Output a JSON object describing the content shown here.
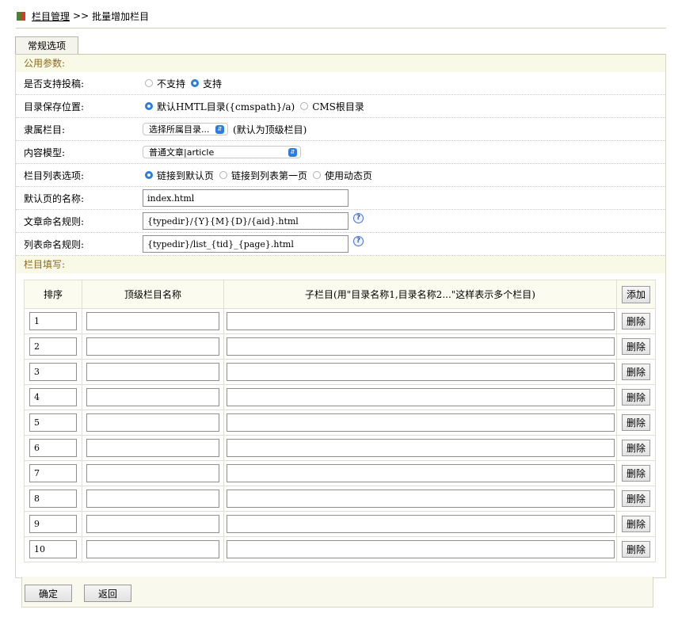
{
  "breadcrumb": {
    "link": "栏目管理",
    "sep": ">>",
    "current": "批量增加栏目"
  },
  "tab": "常规选项",
  "common": {
    "title": "公用参数:",
    "allow_submit": {
      "label": "是否支持投稿:",
      "opt_no": "不支持",
      "opt_yes": "支持",
      "selected": "支持"
    },
    "save_path": {
      "label": "目录保存位置:",
      "opt_default": "默认HMTL目录({cmspath}/a)",
      "opt_root": "CMS根目录",
      "selected": "default"
    },
    "parent": {
      "label": "隶属栏目:",
      "select": "选择所属目录...",
      "note": "(默认为顶级栏目)"
    },
    "model": {
      "label": "内容模型:",
      "select": "普通文章|article"
    },
    "list_option": {
      "label": "栏目列表选项:",
      "opt1": "链接到默认页",
      "opt2": "链接到列表第一页",
      "opt3": "使用动态页",
      "selected": "opt1"
    },
    "default_page": {
      "label": "默认页的名称:",
      "value": "index.html"
    },
    "article_rule": {
      "label": "文章命名规则:",
      "value": "{typedir}/{Y}{M}{D}/{aid}.html"
    },
    "list_rule": {
      "label": "列表命名规则:",
      "value": "{typedir}/list_{tid}_{page}.html"
    }
  },
  "fill": {
    "title": "栏目填写:",
    "headers": {
      "order": "排序",
      "top": "顶级栏目名称",
      "sub": "子栏目(用\"目录名称1,目录名称2...\"这样表示多个栏目)",
      "add": "添加"
    },
    "delete": "删除",
    "rows": [
      "1",
      "2",
      "3",
      "4",
      "5",
      "6",
      "7",
      "8",
      "9",
      "10"
    ]
  },
  "actions": {
    "ok": "确定",
    "back": "返回"
  }
}
